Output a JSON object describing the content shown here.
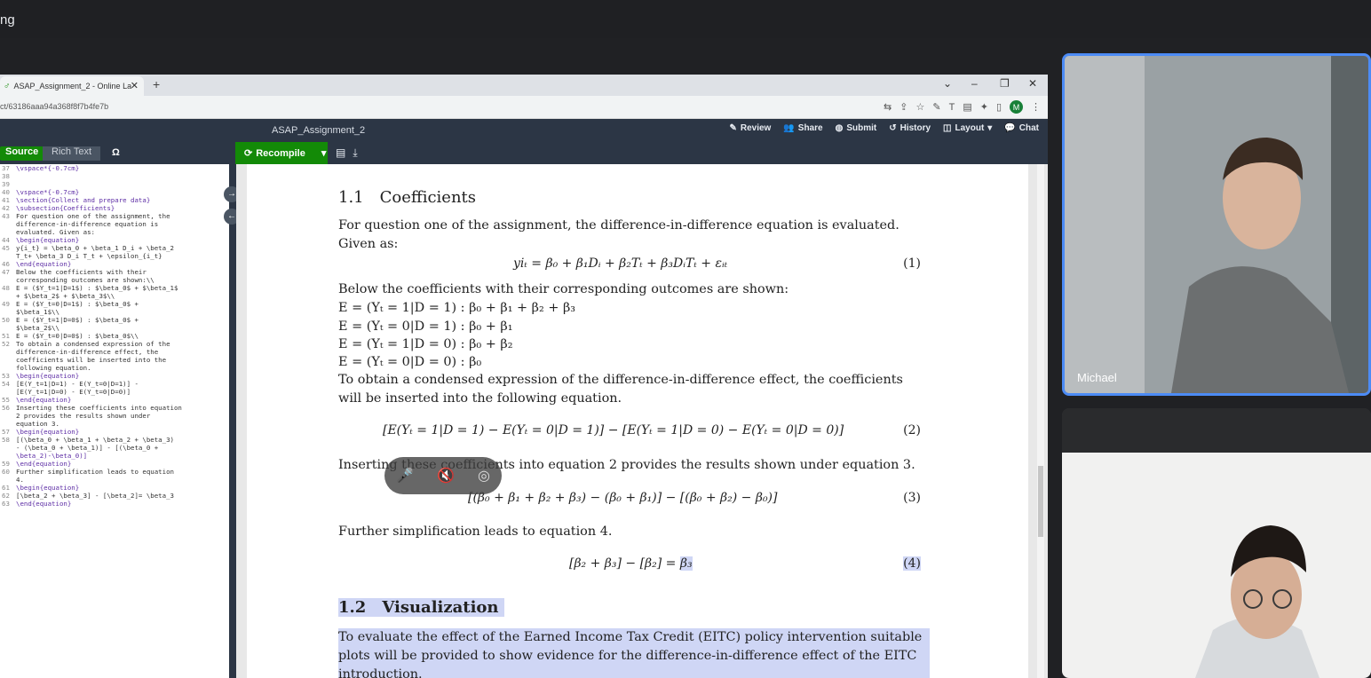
{
  "meet": {
    "title_fragment": "ng"
  },
  "browser": {
    "tab_title": "ASAP_Assignment_2 - Online La",
    "url": "ct/63186aaa94a368f8f7b4fe7b",
    "profile_initial": "M"
  },
  "overleaf": {
    "doc_title": "ASAP_Assignment_2",
    "actions": [
      "Review",
      "Share",
      "Submit",
      "History",
      "Layout",
      "Chat"
    ],
    "source_label": "Source",
    "rich_text_label": "Rich Text",
    "omega": "Ω",
    "recompile_label": "Recompile"
  },
  "editor_lines": [
    {
      "n": "37",
      "t": "\\vspace*{-0.7cm}"
    },
    {
      "n": "38",
      "t": ""
    },
    {
      "n": "39",
      "t": ""
    },
    {
      "n": "40",
      "t": "\\vspace*{-0.7cm}"
    },
    {
      "n": "41",
      "t": "\\section{Collect and prepare data}"
    },
    {
      "n": "42",
      "t": "\\subsection{Coefficients}"
    },
    {
      "n": "43",
      "t": "For question one of the assignment, the"
    },
    {
      "n": "",
      "t": "difference-in-difference equation is"
    },
    {
      "n": "",
      "t": "evaluated. Given as:"
    },
    {
      "n": "44",
      "t": "\\begin{equation}"
    },
    {
      "n": "45",
      "t": "y{i_t} = \\beta_0 + \\beta_1 D_i + \\beta_2"
    },
    {
      "n": "",
      "t": "T_t+ \\beta_3 D_i T_t + \\epsilon_{i_t}"
    },
    {
      "n": "46",
      "t": "\\end{equation}"
    },
    {
      "n": "47",
      "t": "Below the coefficients with their"
    },
    {
      "n": "",
      "t": "corresponding outcomes are shown:\\\\"
    },
    {
      "n": "48",
      "t": "E = ($Y_t=1|D=1$) : $\\beta_0$ + $\\beta_1$"
    },
    {
      "n": "",
      "t": "+ $\\beta_2$ + $\\beta_3$\\\\"
    },
    {
      "n": "49",
      "t": "E = ($Y_t=0|D=1$) : $\\beta_0$ +"
    },
    {
      "n": "",
      "t": "$\\beta_1$\\\\"
    },
    {
      "n": "50",
      "t": "E = ($Y_t=1|D=0$) : $\\beta_0$ +"
    },
    {
      "n": "",
      "t": "$\\beta_2$\\\\"
    },
    {
      "n": "51",
      "t": "E = ($Y_t=0|D=0$) : $\\beta_0$\\\\"
    },
    {
      "n": "52",
      "t": "To obtain a condensed expression of the"
    },
    {
      "n": "",
      "t": "difference-in-difference effect, the"
    },
    {
      "n": "",
      "t": "coefficients will be inserted into the"
    },
    {
      "n": "",
      "t": "following equation."
    },
    {
      "n": "53",
      "t": "\\begin{equation}"
    },
    {
      "n": "54",
      "t": "[E(Y_t=1|D=1) - E(Y_t=0|D=1)] -"
    },
    {
      "n": "",
      "t": "[E(Y_t=1|D=0) - E(Y_t=0|D=0)]"
    },
    {
      "n": "55",
      "t": "\\end{equation}"
    },
    {
      "n": "56",
      "t": "Inserting these coefficients into equation"
    },
    {
      "n": "",
      "t": "2 provides the results shown under"
    },
    {
      "n": "",
      "t": "equation 3."
    },
    {
      "n": "57",
      "t": "\\begin{equation}"
    },
    {
      "n": "58",
      "t": "[(\\beta_0 + \\beta_1 + \\beta_2 + \\beta_3)"
    },
    {
      "n": "",
      "t": "- (\\beta_0 + \\beta_1)] - [(\\beta_0 +"
    },
    {
      "n": "",
      "t": "\\beta_2)-\\beta_0)]"
    },
    {
      "n": "59",
      "t": "\\end{equation}"
    },
    {
      "n": "60",
      "t": "Further simplification leads to equation"
    },
    {
      "n": "",
      "t": "4."
    },
    {
      "n": "61",
      "t": "\\begin{equation}"
    },
    {
      "n": "62",
      "t": "[\\beta_2 + \\beta_3] - [\\beta_2]= \\beta_3"
    },
    {
      "n": "63",
      "t": "\\end{equation}"
    }
  ],
  "pdf": {
    "sec1_num": "1.1",
    "sec1_title": "Coefficients",
    "p1": "For question one of the assignment, the difference-in-difference equation is evaluated. Given as:",
    "eq1": "yiₜ = β₀ + β₁Dᵢ + β₂Tₜ + β₃DᵢTₜ + εᵢₜ",
    "eq1_num": "(1)",
    "p2": "Below the coefficients with their corresponding outcomes are shown:",
    "e_lines": [
      "E = (Yₜ = 1|D = 1) : β₀ + β₁ + β₂ + β₃",
      "E = (Yₜ = 0|D = 1) : β₀ + β₁",
      "E = (Yₜ = 1|D = 0) : β₀ + β₂",
      "E = (Yₜ = 0|D = 0) : β₀"
    ],
    "p3": "To obtain a condensed expression of the difference-in-difference effect, the coefficients will be inserted into the following equation.",
    "eq2": "[E(Yₜ = 1|D = 1) − E(Yₜ = 0|D = 1)] − [E(Yₜ = 1|D = 0) − E(Yₜ = 0|D = 0)]",
    "eq2_num": "(2)",
    "p4": "Inserting these coefficients into equation 2 provides the results shown under equation 3.",
    "eq3": "[(β₀ + β₁ + β₂ + β₃) − (β₀ + β₁)] − [(β₀ + β₂) − β₀)]",
    "eq3_num": "(3)",
    "p5": "Further simplification leads to equation 4.",
    "eq4": "[β₂ + β₃] − [β₂] = ",
    "eq4_hl": "β₃",
    "eq4_num": "(4)",
    "sec2_num": "1.2",
    "sec2_title": "Visualization",
    "p6": "To evaluate the effect of the Earned Income Tax Credit (EITC) policy intervention suitable plots will be provided to show evidence for the difference-in-difference effect of the EITC introduction."
  },
  "participants": [
    {
      "name": "Michael"
    }
  ],
  "colors": {
    "overleaf_green": "#138a07",
    "overleaf_bar": "#2c3645",
    "highlight": "#cfd6f5",
    "active_speaker": "#4c8bf5"
  }
}
